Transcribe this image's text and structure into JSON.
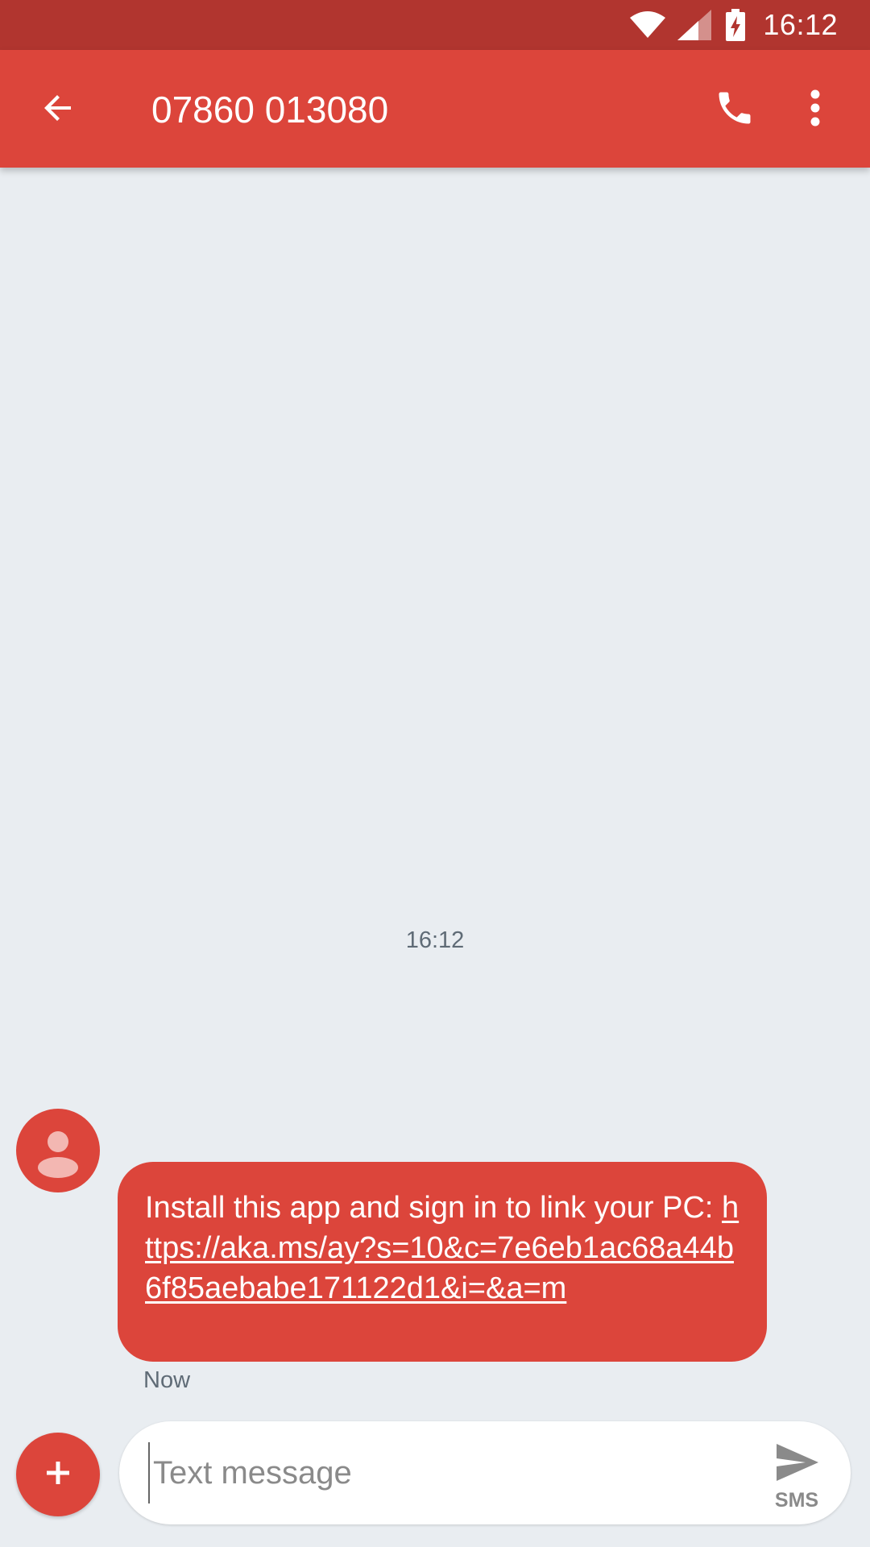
{
  "status_bar": {
    "time": "16:12",
    "icons": [
      "wifi-icon",
      "cell-signal-icon",
      "battery-charging-icon"
    ]
  },
  "app_bar": {
    "title": "07860 013080",
    "back_icon": "arrow-back-icon",
    "call_icon": "phone-icon",
    "more_icon": "more-vert-icon"
  },
  "conversation": {
    "timestamp": "16:12",
    "messages": [
      {
        "text": "Install this app and sign in to link your PC: ",
        "link": "https://aka.ms/ay?s=10&c=7e6eb1ac68a44b6f85aebabe171122d1&i=&a=m",
        "meta": "Now",
        "avatar_icon": "person-icon"
      }
    ]
  },
  "compose": {
    "attach_icon": "plus-icon",
    "placeholder": "Text message",
    "send_icon": "send-icon",
    "send_label": "SMS"
  },
  "colors": {
    "status_bar": "#b1352f",
    "app_bar": "#dc453b",
    "bubble": "#dc453b",
    "background": "#e9edf1"
  }
}
